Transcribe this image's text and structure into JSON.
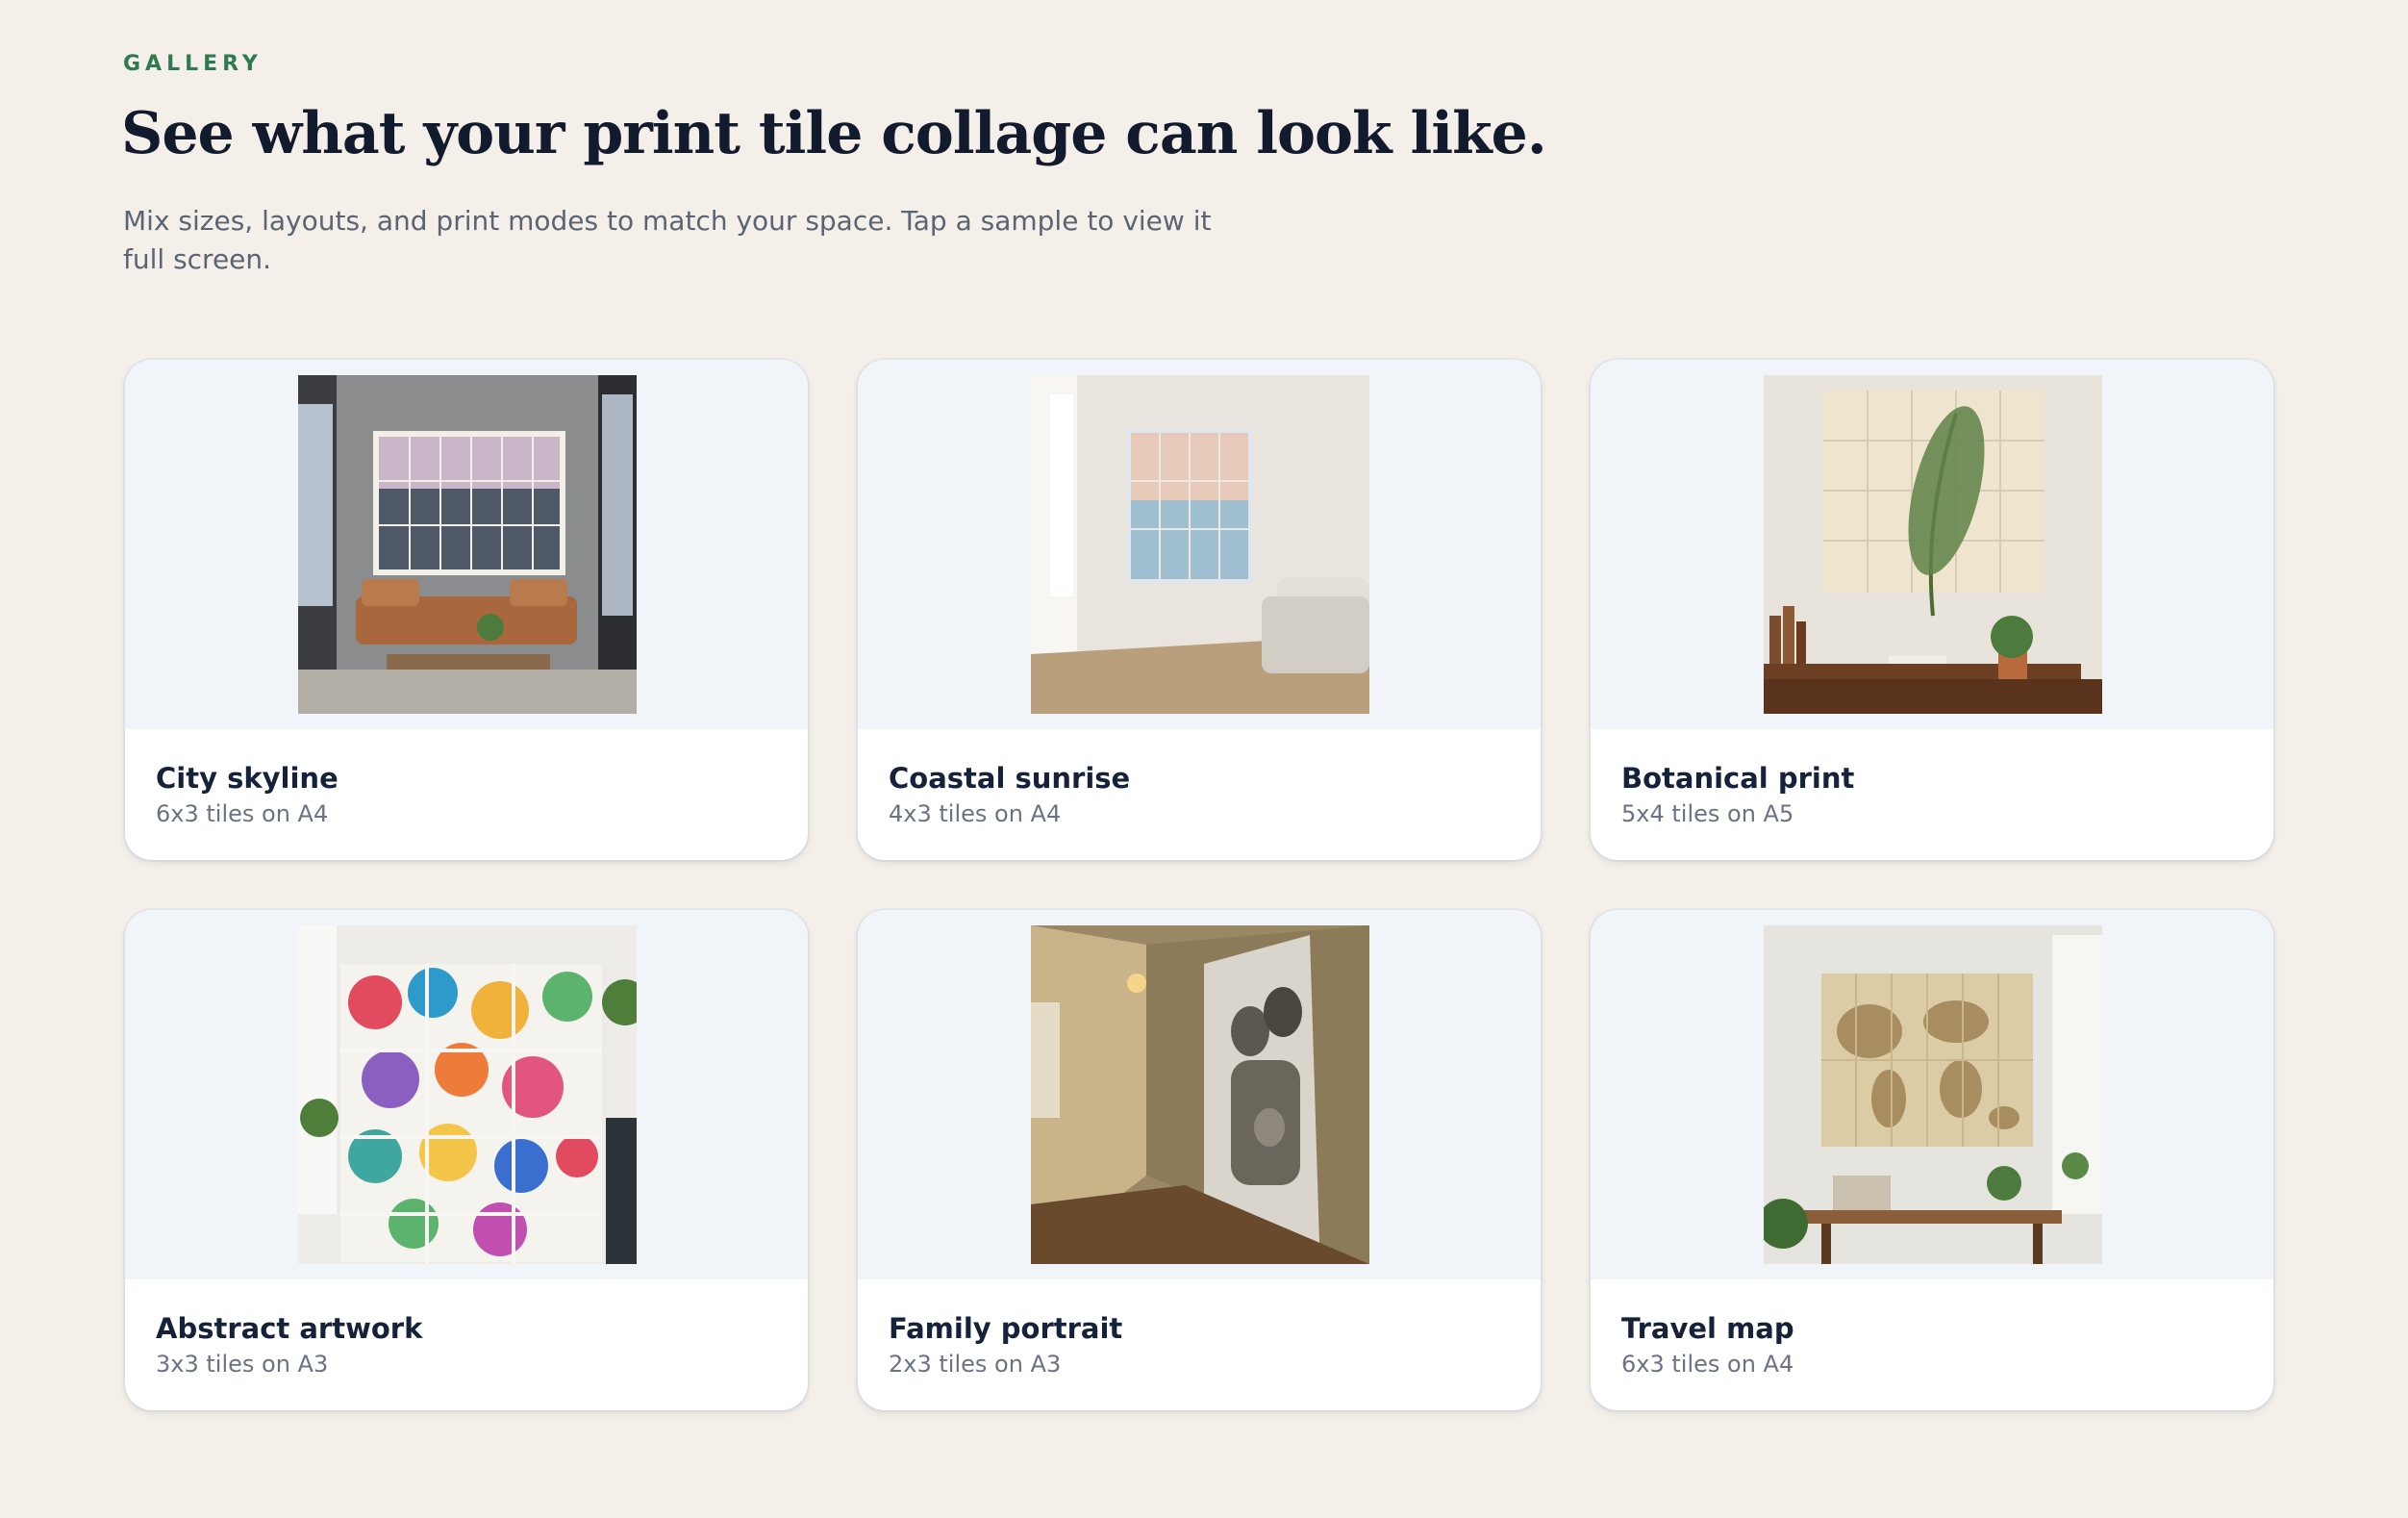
{
  "header": {
    "eyebrow": "GALLERY",
    "title": "See what your print tile collage can look like.",
    "subtitle": "Mix sizes, layouts, and print modes to match your space. Tap a sample to view it full screen."
  },
  "gallery": {
    "items": [
      {
        "title": "City skyline",
        "meta": "6x3 tiles on A4"
      },
      {
        "title": "Coastal sunrise",
        "meta": "4x3 tiles on A4"
      },
      {
        "title": "Botanical print",
        "meta": "5x4 tiles on A5"
      },
      {
        "title": "Abstract artwork",
        "meta": "3x3 tiles on A3"
      },
      {
        "title": "Family portrait",
        "meta": "2x3 tiles on A3"
      },
      {
        "title": "Travel map",
        "meta": "6x3 tiles on A4"
      }
    ]
  },
  "colors": {
    "background": "#f4f0e9",
    "accent": "#2f7a50",
    "heading": "#121a2e",
    "card_media_bg": "#f1f4f8"
  }
}
